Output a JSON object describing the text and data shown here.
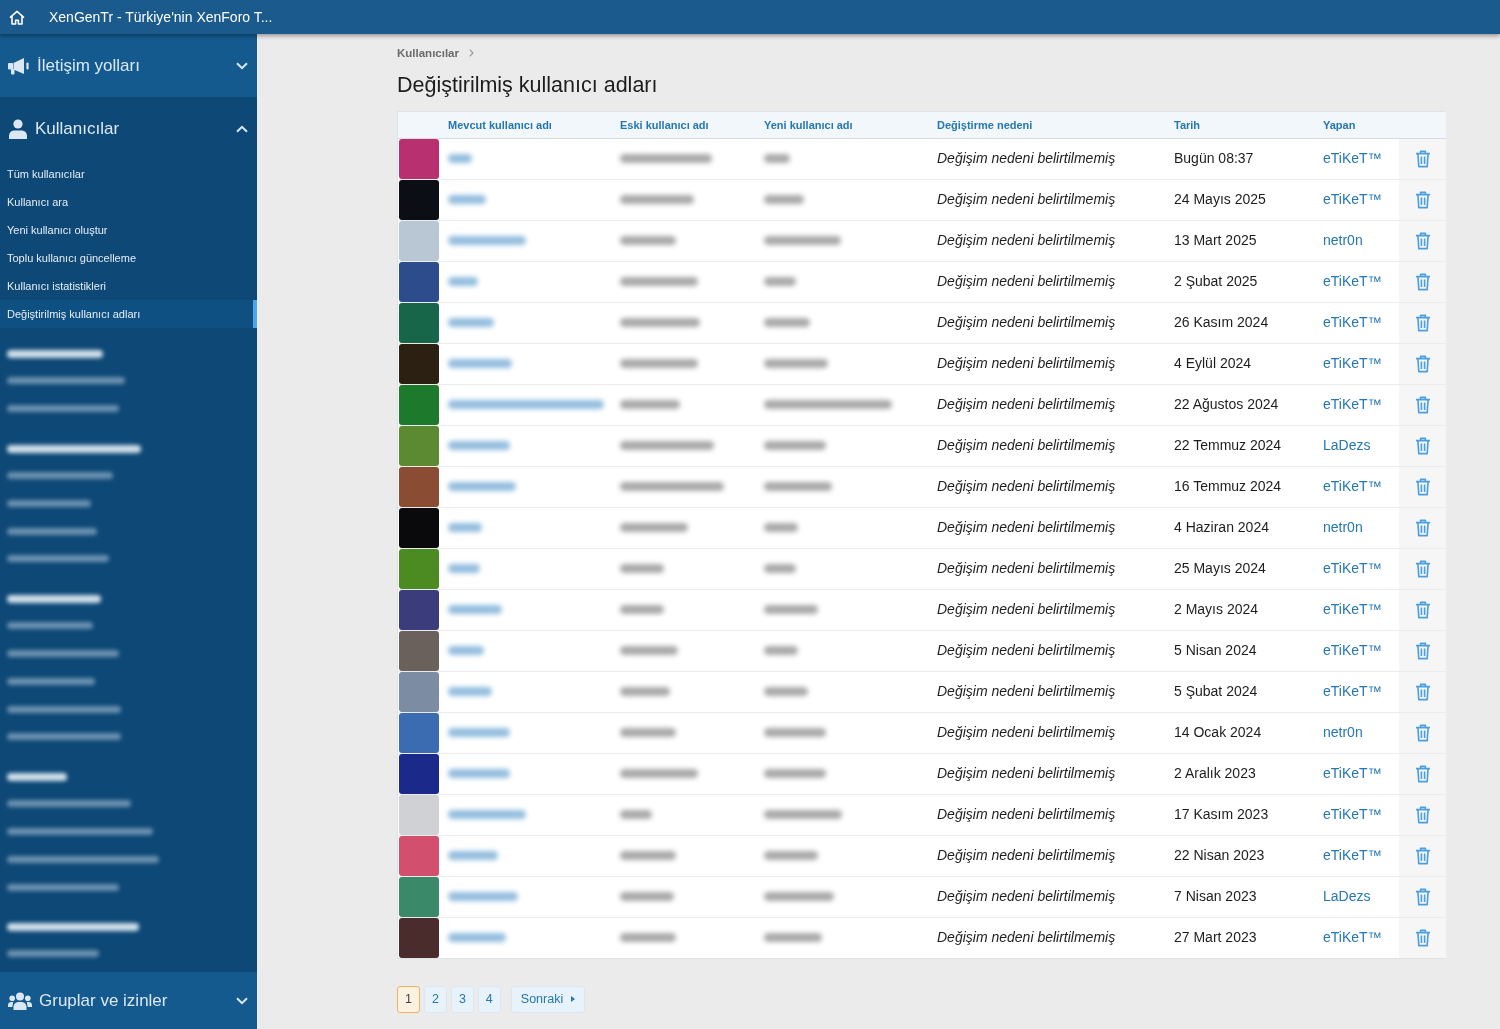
{
  "top_bar": {
    "title": "XenGenTr - Türkiye'nin XenForo T..."
  },
  "sidebar": {
    "sections": [
      {
        "title": "İletişim yolları",
        "expanded": false
      },
      {
        "title": "Kullanıcılar",
        "expanded": true,
        "items": [
          {
            "label": "Tüm kullanıcılar",
            "selected": false
          },
          {
            "label": "Kullanıcı ara",
            "selected": false
          },
          {
            "label": "Yeni kullanıcı oluştur",
            "selected": false
          },
          {
            "label": "Toplu kullanıcı güncelleme",
            "selected": false
          },
          {
            "label": "Kullanıcı istatistikleri",
            "selected": false
          },
          {
            "label": "Değiştirilmiş kullanıcı adları",
            "selected": true
          }
        ]
      },
      {
        "title": "Gruplar ve izinler",
        "expanded": false
      }
    ]
  },
  "breadcrumb": [
    "Kullanıcılar"
  ],
  "page_title": "Değiştirilmiş kullanıcı adları",
  "table": {
    "columns": [
      "Mevcut kullanıcı adı",
      "Eski kullanıcı adı",
      "Yeni kullanıcı adı",
      "Değiştirme nedeni",
      "Tarih",
      "Yapan"
    ],
    "rows": [
      {
        "avatar": {
          "color": "#b8306f"
        },
        "reason": "Değişim nedeni belirtilmemiş",
        "date": "Bugün 08:37",
        "by": "eTiKeT™"
      },
      {
        "avatar": {
          "color": "#0b0e15"
        },
        "reason": "Değişim nedeni belirtilmemiş",
        "date": "24 Mayıs 2025",
        "by": "eTiKeT™"
      },
      {
        "avatar": {
          "color": "#b9c6d4"
        },
        "reason": "Değişim nedeni belirtilmemiş",
        "date": "13 Mart 2025",
        "by": "netr0n"
      },
      {
        "avatar": {
          "color": "#2d4c8c"
        },
        "reason": "Değişim nedeni belirtilmemiş",
        "date": "2 Şubat 2025",
        "by": "eTiKeT™"
      },
      {
        "avatar": {
          "color": "#17664a"
        },
        "reason": "Değişim nedeni belirtilmemiş",
        "date": "26 Kasım 2024",
        "by": "eTiKeT™"
      },
      {
        "avatar": {
          "color": "#2b2012"
        },
        "reason": "Değişim nedeni belirtilmemiş",
        "date": "4 Eylül 2024",
        "by": "eTiKeT™"
      },
      {
        "avatar": {
          "color": "#1d7a2c"
        },
        "reason": "Değişim nedeni belirtilmemiş",
        "date": "22 Ağustos 2024",
        "by": "eTiKeT™"
      },
      {
        "avatar": {
          "color": "#5b8a32"
        },
        "reason": "Değişim nedeni belirtilmemiş",
        "date": "22 Temmuz 2024",
        "by": "LaDezs"
      },
      {
        "avatar": {
          "color": "#8a4c32"
        },
        "reason": "Değişim nedeni belirtilmemiş",
        "date": "16 Temmuz 2024",
        "by": "eTiKeT™"
      },
      {
        "avatar": {
          "color": "#0a0a0c"
        },
        "reason": "Değişim nedeni belirtilmemiş",
        "date": "4 Haziran 2024",
        "by": "netr0n"
      },
      {
        "avatar": {
          "color": "#4c8a22"
        },
        "reason": "Değişim nedeni belirtilmemiş",
        "date": "25 Mayıs 2024",
        "by": "eTiKeT™"
      },
      {
        "avatar": {
          "color": "#3b3c7c"
        },
        "reason": "Değişim nedeni belirtilmemiş",
        "date": "2 Mayıs 2024",
        "by": "eTiKeT™"
      },
      {
        "avatar": {
          "color": "#6a605c"
        },
        "reason": "Değişim nedeni belirtilmemiş",
        "date": "5 Nisan 2024",
        "by": "eTiKeT™"
      },
      {
        "avatar": {
          "color": "#7c8ca2"
        },
        "reason": "Değişim nedeni belirtilmemiş",
        "date": "5 Şubat 2024",
        "by": "eTiKeT™"
      },
      {
        "avatar": {
          "color": "#3b6cb2"
        },
        "reason": "Değişim nedeni belirtilmemiş",
        "date": "14 Ocak 2024",
        "by": "netr0n"
      },
      {
        "avatar": {
          "color": "#1b2a8a"
        },
        "reason": "Değişim nedeni belirtilmemiş",
        "date": "2 Aralık 2023",
        "by": "eTiKeT™"
      },
      {
        "avatar": {
          "color": "#cfd1d4"
        },
        "reason": "Değişim nedeni belirtilmemiş",
        "date": "17 Kasım 2023",
        "by": "eTiKeT™"
      },
      {
        "avatar": {
          "color": "#d2506e"
        },
        "reason": "Değişim nedeni belirtilmemiş",
        "date": "22 Nisan 2023",
        "by": "eTiKeT™"
      },
      {
        "avatar": {
          "color": "#3a8a6a"
        },
        "reason": "Değişim nedeni belirtilmemiş",
        "date": "7 Nisan 2023",
        "by": "LaDezs"
      },
      {
        "avatar": {
          "color": "#4a2c2c"
        },
        "reason": "Değişim nedeni belirtilmemiş",
        "date": "27 Mart 2023",
        "by": "eTiKeT™"
      }
    ]
  },
  "pagination": {
    "pages": [
      {
        "label": "1",
        "selected": true
      },
      {
        "label": "2",
        "selected": false
      },
      {
        "label": "3",
        "selected": false
      },
      {
        "label": "4",
        "selected": false
      }
    ],
    "next": "Sonraki"
  }
}
